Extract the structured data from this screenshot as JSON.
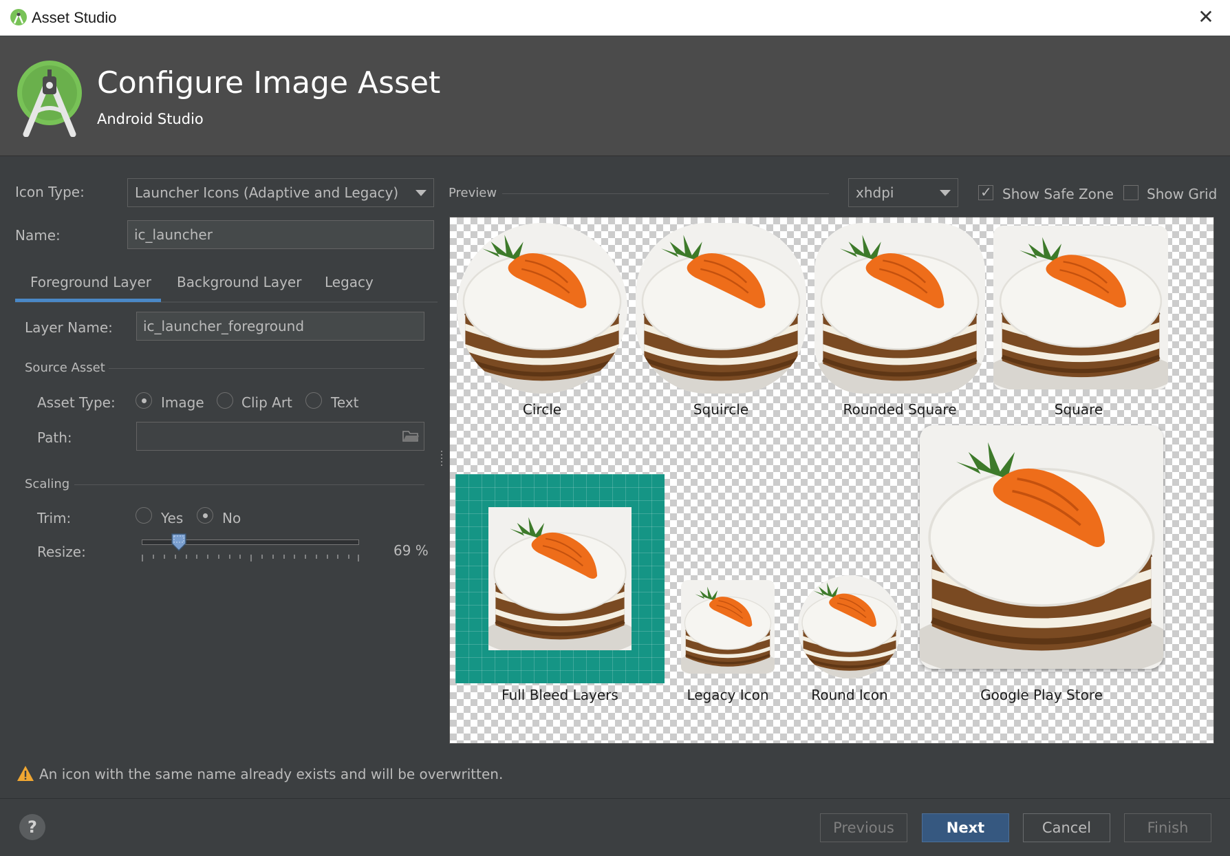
{
  "window": {
    "title": "Asset Studio",
    "close_glyph": "✕"
  },
  "banner": {
    "title": "Configure Image Asset",
    "subtitle": "Android Studio"
  },
  "form": {
    "icon_type_label": "Icon Type:",
    "icon_type_value": "Launcher Icons (Adaptive and Legacy)",
    "name_label": "Name:",
    "name_value": "ic_launcher",
    "tabs": [
      "Foreground Layer",
      "Background Layer",
      "Legacy"
    ],
    "layer_name_label": "Layer Name:",
    "layer_name_value": "ic_launcher_foreground",
    "source_asset_label": "Source Asset",
    "asset_type_label": "Asset Type:",
    "asset_type_options": [
      "Image",
      "Clip Art",
      "Text"
    ],
    "asset_type_selected": "Image",
    "path_label": "Path:",
    "path_value": "",
    "scaling_label": "Scaling",
    "trim_label": "Trim:",
    "trim_options": [
      "Yes",
      "No"
    ],
    "trim_selected": "No",
    "resize_label": "Resize:",
    "resize_value": "69 %",
    "resize_percent": 69
  },
  "preview": {
    "label": "Preview",
    "density_value": "xhdpi",
    "show_safe_zone_label": "Show Safe Zone",
    "show_safe_zone_checked": true,
    "show_grid_label": "Show Grid",
    "show_grid_checked": false,
    "captions": {
      "circle": "Circle",
      "squircle": "Squircle",
      "rounded_square": "Rounded Square",
      "square": "Square",
      "full_bleed": "Full Bleed Layers",
      "legacy": "Legacy Icon",
      "round": "Round Icon",
      "play_store": "Google Play Store"
    }
  },
  "warning": {
    "text": "An icon with the same name already exists and will be overwritten.",
    "icon": "warning-icon"
  },
  "footer": {
    "help_glyph": "?",
    "previous": "Previous",
    "next": "Next",
    "cancel": "Cancel",
    "finish": "Finish"
  },
  "colors": {
    "accent": "#4a88c7",
    "primary_button": "#365880",
    "full_bleed_bg": "#159585"
  }
}
